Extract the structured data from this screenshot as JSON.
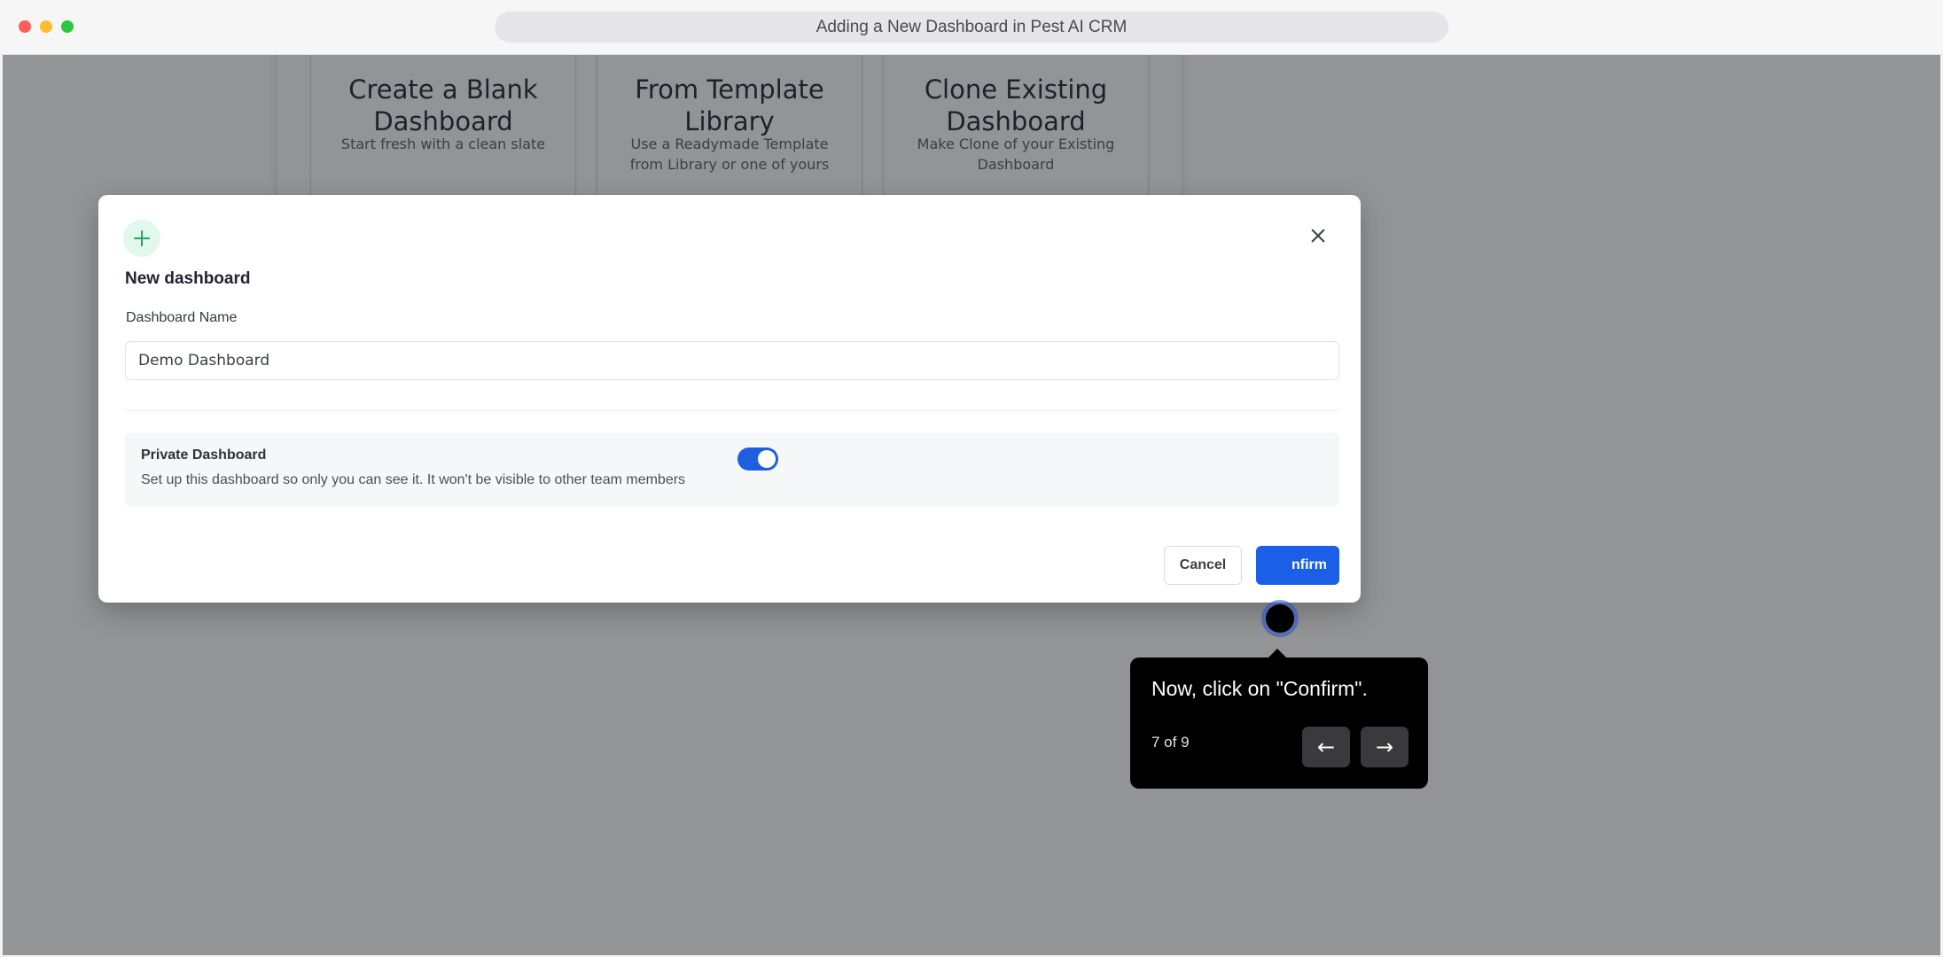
{
  "window": {
    "url_title": "Adding a New Dashboard in Pest AI CRM"
  },
  "background_cards": [
    {
      "title": "Create a Blank Dashboard",
      "description": "Start fresh with a clean slate"
    },
    {
      "title": "From Template Library",
      "description": "Use a Readymade Template from Library or one of yours"
    },
    {
      "title": "Clone Existing Dashboard",
      "description": "Make Clone of your Existing Dashboard"
    }
  ],
  "modal": {
    "icon": "plus-icon",
    "title": "New dashboard",
    "name_label": "Dashboard Name",
    "name_value": "Demo Dashboard",
    "private": {
      "title": "Private Dashboard",
      "description": "Set up this dashboard so only you can see it. It won't be visible to other team members",
      "enabled": true
    },
    "cancel_label": "Cancel",
    "confirm_label": "nfirm"
  },
  "tooltip": {
    "text": "Now, click on \"Confirm\".",
    "step": "7 of 9",
    "prev_icon": "arrow-left-icon",
    "next_icon": "arrow-right-icon"
  },
  "colors": {
    "primary": "#1a5fe6",
    "toggle_on": "#1e5fe0",
    "success_icon": "#22a55c",
    "tooltip_bg": "#000000"
  }
}
